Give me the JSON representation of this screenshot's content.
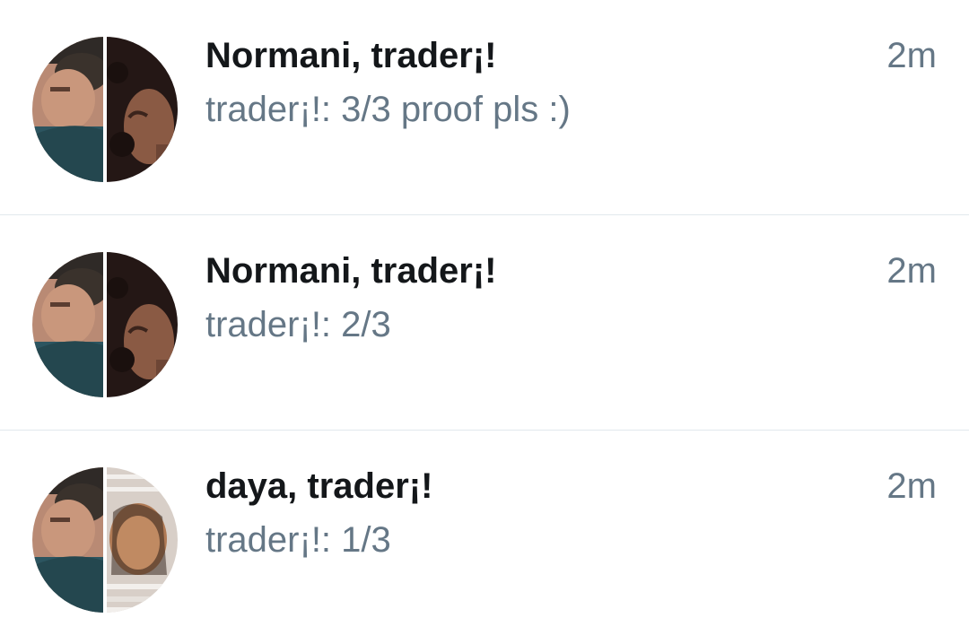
{
  "conversations": [
    {
      "title": "Normani, trader¡!",
      "preview": "trader¡!: 3/3 proof pls :)",
      "time": "2m"
    },
    {
      "title": "Normani, trader¡!",
      "preview": "trader¡!: 2/3",
      "time": "2m"
    },
    {
      "title": "daya, trader¡!",
      "preview": "trader¡!: 1/3",
      "time": "2m"
    }
  ],
  "colors": {
    "title": "#14171a",
    "secondary": "#657786",
    "divider": "#e1e8ed"
  }
}
